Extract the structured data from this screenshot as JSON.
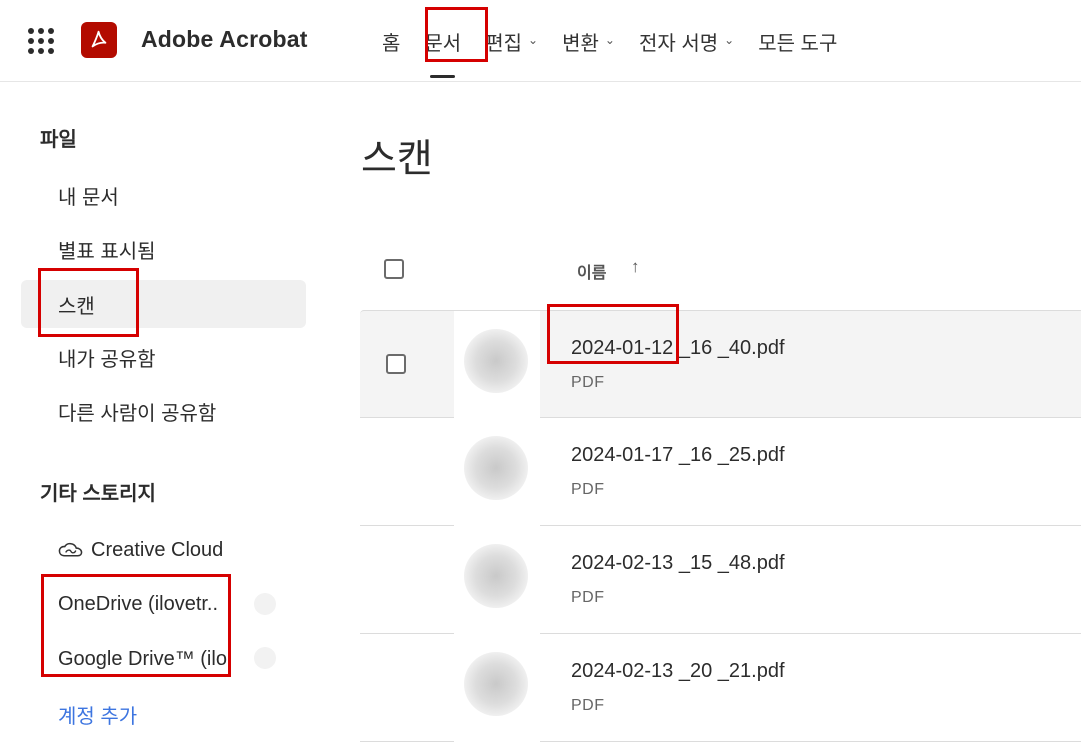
{
  "header": {
    "brand": "Adobe Acrobat",
    "nav": [
      {
        "label": "홈",
        "has_menu": false
      },
      {
        "label": "문서",
        "has_menu": false,
        "active": true
      },
      {
        "label": "편집",
        "has_menu": true
      },
      {
        "label": "변환",
        "has_menu": true
      },
      {
        "label": "전자 서명",
        "has_menu": true
      },
      {
        "label": "모든 도구",
        "has_menu": false
      }
    ],
    "icons": {
      "apps": "app-grid-icon",
      "logo": "acrobat-logo-icon",
      "dropdown": "chevron-down-icon"
    }
  },
  "sidebar": {
    "files_title": "파일",
    "items": [
      {
        "label": "내 문서"
      },
      {
        "label": "별표 표시됨"
      },
      {
        "label": "스캔",
        "selected": true
      },
      {
        "label": "내가 공유함"
      },
      {
        "label": "다른 사람이 공유함"
      }
    ],
    "storage_title": "기타 스토리지",
    "storage": [
      {
        "label": "Creative Cloud",
        "icon": "creative-cloud-icon"
      },
      {
        "label": "OneDrive (ilovetr.."
      },
      {
        "label": "Google Drive™ (ilo.."
      }
    ],
    "add_account": "계정 추가"
  },
  "main": {
    "title": "스캔",
    "column_name": "이름",
    "sort_icon": "arrow-up-icon",
    "files": [
      {
        "name": "2024-01-12 _16 _40.pdf",
        "type": "PDF",
        "hover": true
      },
      {
        "name": "2024-01-17 _16 _25.pdf",
        "type": "PDF"
      },
      {
        "name": "2024-02-13 _15 _48.pdf",
        "type": "PDF"
      },
      {
        "name": "2024-02-13 _20 _21.pdf",
        "type": "PDF"
      }
    ]
  },
  "colors": {
    "accent_red": "#d50000",
    "logo_red": "#b30b00",
    "link_blue": "#3d75e0",
    "selected_bg": "#f0f0f0"
  }
}
